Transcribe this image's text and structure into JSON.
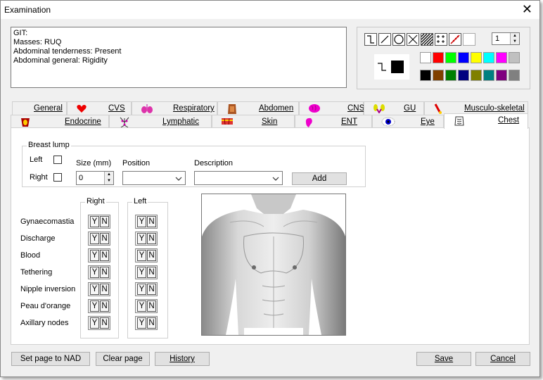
{
  "window": {
    "title": "Examination",
    "close_glyph": "✕"
  },
  "notes": {
    "lines": [
      "GIT:",
      "Masses: RUQ",
      "Abdominal tenderness: Present",
      "Abdominal general:  Rigidity"
    ]
  },
  "toolbar": {
    "tools": [
      "freehand-tool",
      "line-tool",
      "circle-tool",
      "cross-tool",
      "hatch-tool",
      "dots-tool",
      "ruler-tool",
      "blank-tool"
    ],
    "line_width": "1",
    "current_color": "#000000",
    "palette_row1": [
      "#ffffff",
      "#ff0000",
      "#00ff00",
      "#0000ff",
      "#ffff00",
      "#00ffff",
      "#ff00ff",
      "#c0c0c0"
    ],
    "palette_row2": [
      "#000000",
      "#804000",
      "#008000",
      "#000080",
      "#808000",
      "#008080",
      "#800080",
      "#808080"
    ]
  },
  "tabs_row1": [
    {
      "label": "General",
      "icon": ""
    },
    {
      "label": "CVS",
      "icon": "heart-icon"
    },
    {
      "label": "Respiratory",
      "icon": "lungs-icon"
    },
    {
      "label": "Abdomen",
      "icon": "abdomen-icon"
    },
    {
      "label": "CNS",
      "icon": "brain-icon"
    },
    {
      "label": "GU",
      "icon": "kidney-icon"
    },
    {
      "label": "Musculo-skeletal",
      "icon": "bone-icon"
    }
  ],
  "tabs_row2": [
    {
      "label": "Endocrine",
      "icon": "thyroid-icon"
    },
    {
      "label": "Lymphatic",
      "icon": "lymph-icon"
    },
    {
      "label": "Skin",
      "icon": "skin-icon"
    },
    {
      "label": "ENT",
      "icon": "ear-icon"
    },
    {
      "label": "Eye",
      "icon": "eye-icon"
    },
    {
      "label": "Chest",
      "icon": "chest-icon"
    }
  ],
  "breast_lump": {
    "title": "Breast lump",
    "left_label": "Left",
    "right_label": "Right",
    "size_label": "Size (mm)",
    "size_value": "0",
    "position_label": "Position",
    "description_label": "Description",
    "add_label": "Add"
  },
  "findings": {
    "right_title": "Right",
    "left_title": "Left",
    "yes": "Y",
    "no": "N",
    "rows": [
      "Gynaecomastia",
      "Discharge",
      "Blood",
      "Tethering",
      "Nipple inversion",
      "Peau d'orange",
      "Axillary nodes"
    ]
  },
  "footer": {
    "nad": "Set page to NAD",
    "clear": "Clear page",
    "history": "History",
    "save": "Save",
    "cancel": "Cancel"
  }
}
